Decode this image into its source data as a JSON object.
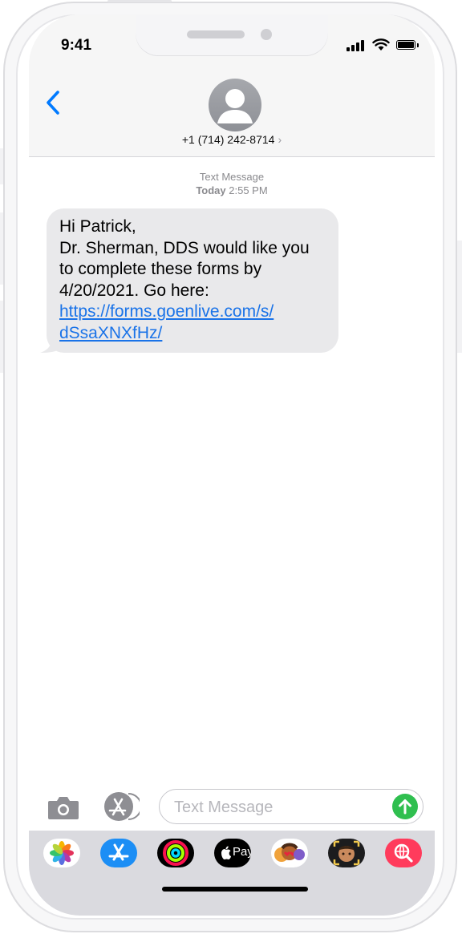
{
  "status_bar": {
    "time": "9:41"
  },
  "header": {
    "contact": "+1 (714) 242-8714",
    "chevron": "›"
  },
  "thread": {
    "service": "Text Message",
    "day": "Today",
    "time": "2:55 PM"
  },
  "message": {
    "lines": [
      "Hi Patrick,",
      "Dr. Sherman, DDS would like you",
      "to complete these forms by",
      "4/20/2021. Go here:"
    ],
    "link_lines": [
      "https://forms.goenlive.com/s/",
      "dSsaXNXfHz/"
    ]
  },
  "composer": {
    "placeholder": "Text Message",
    "value": ""
  },
  "app_drawer": {
    "items": [
      "photos-icon",
      "app-store-icon",
      "activity-icon",
      "apple-pay-icon",
      "animoji-icon",
      "memoji-icon",
      "web-search-icon"
    ],
    "apple_pay_label": "Pay"
  },
  "colors": {
    "accent": "#007aff",
    "send": "#2fbf4f",
    "bubble": "#e9e9eb",
    "link": "#1a73e8"
  }
}
